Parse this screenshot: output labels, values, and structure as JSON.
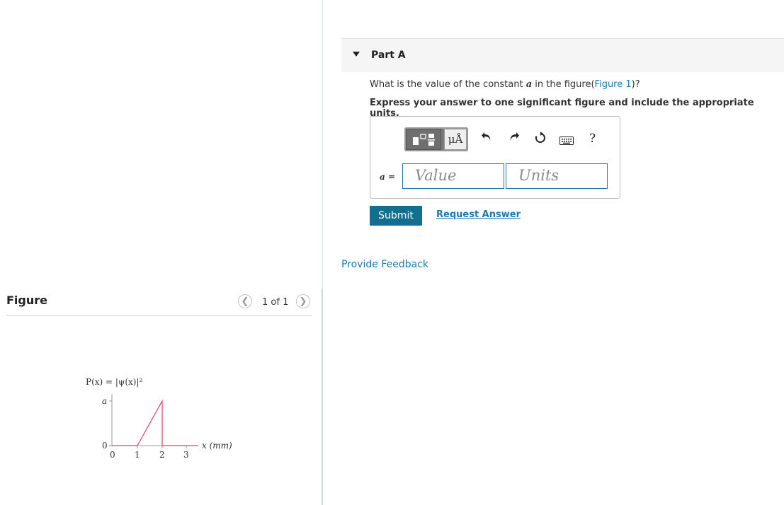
{
  "part": {
    "title": "Part A"
  },
  "question": {
    "prefix": "What is the value of the constant ",
    "variable": "a",
    "middle": " in the figure(",
    "link": "Figure 1",
    "suffix": ")?"
  },
  "instruction": "Express your answer to one significant figure and include the appropriate units.",
  "toolbar": {
    "units_label": "μÅ",
    "help_label": "?",
    "icons": [
      "templates-icon",
      "units-icon",
      "undo-icon",
      "redo-icon",
      "reset-icon",
      "keyboard-icon",
      "help-icon"
    ]
  },
  "answer": {
    "variable_label": "a =",
    "value_placeholder": "Value",
    "units_placeholder": "Units"
  },
  "buttons": {
    "submit": "Submit",
    "request_answer": "Request Answer"
  },
  "feedback": "Provide Feedback",
  "figure": {
    "title": "Figure",
    "pager": "1 of 1",
    "plot": {
      "ylabel": "P(x) = |ψ(x)|²",
      "xlabel": "x (mm)",
      "yticks": [
        "a",
        "0"
      ],
      "xticks": [
        "0",
        "1",
        "2",
        "3"
      ],
      "line_color": "#e0406a"
    }
  },
  "colors": {
    "accent": "#11708f",
    "link": "#1a7ab0"
  }
}
